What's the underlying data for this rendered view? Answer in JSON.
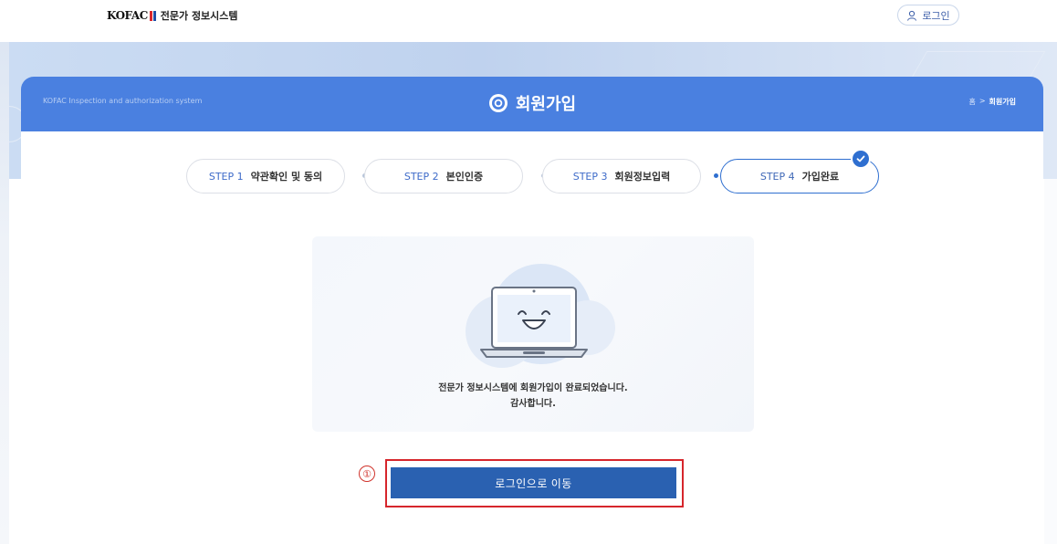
{
  "header": {
    "logo_brand": "KOFAC",
    "logo_title": "전문가 정보시스템",
    "login_label": "로그인"
  },
  "band": {
    "subtitle": "KOFAC Inspection and authorization system",
    "title": "회원가입",
    "breadcrumb_home": "홈",
    "breadcrumb_sep": ">",
    "breadcrumb_current": "회원가입"
  },
  "steps": [
    {
      "num": "STEP 1",
      "name": "약관확인 및 동의"
    },
    {
      "num": "STEP 2",
      "name": "본인인증"
    },
    {
      "num": "STEP 3",
      "name": "회원정보입력"
    },
    {
      "num": "STEP 4",
      "name": "가입완료",
      "active": true
    }
  ],
  "completion": {
    "message_line1": "전문가 정보시스템에 회원가입이 완료되었습니다.",
    "message_line2": "감사합니다."
  },
  "action": {
    "marker": "①",
    "go_login_label": "로그인으로 이동"
  },
  "colors": {
    "band": "#4a80e0",
    "primary_button": "#2a61b1",
    "highlight_border": "#d6262c",
    "active_step": "#2f6fd0"
  }
}
